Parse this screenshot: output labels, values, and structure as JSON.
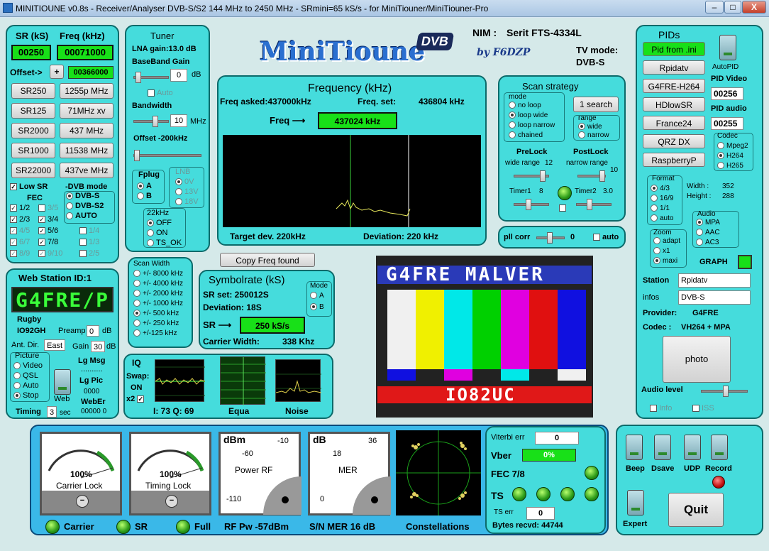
{
  "window": {
    "title": "MINITIOUNE v0.8s - Receiver/Analyser DVB-S/S2 144 MHz to 2450 MHz - SRmini=65 kS/s - for MiniTiouner/MiniTiouner-Pro",
    "min": "–",
    "max": "□",
    "close": "X"
  },
  "sr": {
    "sr_label": "SR (kS)",
    "freq_label": "Freq (kHz)",
    "sr_value": "00250",
    "freq_value": "00071000",
    "offset_label": "Offset->",
    "offset_btn": "+",
    "offset_value": "00366000",
    "sr_buttons": [
      "SR250",
      "SR125",
      "SR2000",
      "SR1000",
      "SR22000"
    ],
    "freq_buttons": [
      "1255p MHz",
      "71MHz xv",
      "437 MHz",
      "11538 MHz",
      "437ve MHz"
    ],
    "low_sr": "Low SR",
    "fec_label": "FEC",
    "dvb_mode_label": "-DVB mode",
    "fec_col1": [
      "1/2",
      "2/3",
      "4/5",
      "6/7",
      "8/9"
    ],
    "fec_col2": [
      "3/5",
      "3/4",
      "5/6",
      "7/8",
      "9/10"
    ],
    "fec_col3": [
      "1/4",
      "1/3",
      "2/5"
    ],
    "dvb_modes": [
      "DVB-S",
      "DVB-S2",
      "AUTO"
    ]
  },
  "tuner": {
    "title": "Tuner",
    "lna": "LNA gain:13.0 dB",
    "bb_label": "BaseBand Gain",
    "bb_value": "0",
    "bb_unit": "dB",
    "auto": "Auto",
    "bw_label": "Bandwidth",
    "bw_value": "10",
    "bw_unit": "MHz",
    "offset": "Offset -200kHz",
    "fplug": "Fplug",
    "fplug_opts": [
      "A",
      "B"
    ],
    "lnb": "LNB",
    "lnb_opts": [
      "0V",
      "13V",
      "18V"
    ],
    "k22": "22kHz",
    "k22_opts": [
      "OFF",
      "ON",
      "TS_OK"
    ]
  },
  "logo": {
    "text": "MiniTioune",
    "badge": "DVB",
    "sig": "by F6DZP"
  },
  "nim": {
    "label": "NIM :",
    "value": "Serit FTS-4334L",
    "tv_mode_label": "TV mode:",
    "tv_mode": "DVB-S"
  },
  "freq": {
    "title": "Frequency (kHz)",
    "asked": "Freq asked:437000kHz",
    "set_label": "Freq. set:",
    "set_value": "436804 kHz",
    "arrow_label": "Freq ⟶",
    "value": "437024 kHz",
    "target": "Target dev. 220kHz",
    "deviation": "Deviation: 220 kHz"
  },
  "scan": {
    "title": "Scan strategy",
    "mode": "mode",
    "modes": [
      "no loop",
      "loop wide",
      "loop narrow",
      "chained"
    ],
    "search": "1 search",
    "range": "range",
    "ranges": [
      "wide",
      "narrow"
    ],
    "prelock": "PreLock",
    "postlock": "PostLock",
    "wide_range": "wide range",
    "wide_val": "12",
    "narrow_range": "narrow range",
    "narrow_val": "10",
    "timer1": "Timer1",
    "timer1_val": "8",
    "timer2": "Timer2",
    "timer2_val": "3.0"
  },
  "pll": {
    "label": "pll corr",
    "value": "0",
    "auto": "auto"
  },
  "pids": {
    "title": "PIDs",
    "buttons": [
      "Pid from .ini",
      "Rpidatv",
      "G4FRE-H264",
      "HDlowSR",
      "France24",
      "QRZ DX",
      "RaspberryP"
    ],
    "autopid": "AutoPID",
    "pid_video_label": "PID Video",
    "pid_video": "00256",
    "pid_audio_label": "PID audio",
    "pid_audio": "00255",
    "codec": "Codec",
    "codecs": [
      "Mpeg2",
      "H264",
      "H265"
    ],
    "format": "Format",
    "formats": [
      "4/3",
      "16/9",
      "1/1",
      "auto"
    ],
    "width_label": "Width :",
    "width": "352",
    "height_label": "Height :",
    "height": "288",
    "audio": "Audio",
    "audios": [
      "MPA",
      "AAC",
      "AC3"
    ],
    "zoom": "Zoom",
    "zooms": [
      "adapt",
      "x1",
      "maxi"
    ],
    "graph": "GRAPH",
    "station_label": "Station",
    "station": "Rpidatv",
    "infos_label": "infos",
    "infos": "DVB-S",
    "provider_label": "Provider:",
    "provider": "G4FRE",
    "codec_label": "Codec :",
    "codec_value": "VH264 + MPA",
    "photo": "photo",
    "audio_level": "Audio level",
    "info": "Info",
    "iss": "ISS"
  },
  "copy_freq": "Copy Freq found",
  "scanwidth": {
    "title": "Scan Width",
    "opts": [
      "+/- 8000 kHz",
      "+/- 4000 kHz",
      "+/- 2000 kHz",
      "+/- 1000 kHz",
      "+/- 500 kHz",
      "+/- 250 kHz",
      "+/-125 kHz"
    ]
  },
  "symbol": {
    "title": "Symbolrate (kS)",
    "srset": "SR set:  250012S",
    "deviation": "Deviation: 18S",
    "arrow": "SR ⟶",
    "value": "250 kS/s",
    "carrier": "Carrier Width:",
    "carrier_val": "338 Khz",
    "mode": "Mode",
    "modes": [
      "A",
      "B"
    ]
  },
  "iq": {
    "title": "IQ",
    "swap": "Swap:",
    "on": "ON",
    "x2": "x2",
    "iq_vals": "I: 73 Q: 69",
    "equa": "Equa",
    "noise": "Noise"
  },
  "web": {
    "title": "Web Station ID:1",
    "callsign": "G4FRE/P",
    "location": "Rugby",
    "locator": "IO92GH",
    "preamp": "Preamp",
    "preamp_val": "0",
    "db": "dB",
    "ant": "Ant. Dir.",
    "ant_val": "East",
    "gain": "Gain",
    "gain_val": "30",
    "picture": "Picture",
    "pics": [
      "Video",
      "QSL",
      "Auto",
      "Stop"
    ],
    "web": "Web",
    "lgmsg": "Lg Msg",
    "dots": "..........",
    "lgpic": "Lg Pic",
    "lgpic_val": "0000",
    "weber": "WebEr",
    "weber_val": "00000 0",
    "timing": "Timing",
    "timing_val": "3",
    "sec": "sec"
  },
  "video": {
    "top": "G4FRE MALVER",
    "bottom": "IO82UC"
  },
  "meters": {
    "carrier_pct": "100%",
    "carrier_label": "Carrier Lock",
    "timing_pct": "100%",
    "timing_label": "Timing Lock",
    "dbm": "dBm",
    "dbm_m60": "-60",
    "dbm_m10": "-10",
    "dbm_m110": "-110",
    "power_rf": "Power RF",
    "db": "dB",
    "db18": "18",
    "db36": "36",
    "db0": "0",
    "mer": "MER"
  },
  "status": {
    "carrier": "Carrier",
    "sr": "SR",
    "full": "Full",
    "rfpw": "RF Pw -57dBm",
    "snmer": "S/N MER  16 dB",
    "constellations": "Constellations"
  },
  "viterbi": {
    "viterbi": "Viterbi err",
    "viterbi_val": "0",
    "vber": "Vber",
    "vber_val": "0%",
    "fec": "FEC 7/8",
    "ts": "TS",
    "ts_err": "TS err",
    "ts_err_val": "0",
    "bytes": "Bytes recvd:  44744"
  },
  "switches": {
    "beep": "Beep",
    "dsave": "Dsave",
    "udp": "UDP",
    "record": "Record",
    "expert": "Expert",
    "quit": "Quit"
  },
  "colors": {
    "panel": "#45dcdc",
    "panel_border": "#0c6a6a",
    "green": "#18e018"
  }
}
